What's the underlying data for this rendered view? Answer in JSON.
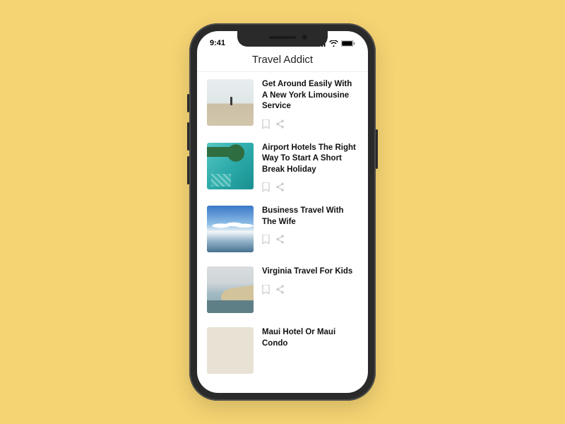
{
  "status": {
    "time": "9:41"
  },
  "header": {
    "title": "Travel Addict"
  },
  "articles": [
    {
      "title": "Get Around Easily With A New York Limousine Service"
    },
    {
      "title": "Airport Hotels The Right Way To Start A Short Break Holiday"
    },
    {
      "title": "Business Travel With The Wife"
    },
    {
      "title": "Virginia Travel For Kids"
    },
    {
      "title": "Maui Hotel Or Maui Condo"
    }
  ]
}
